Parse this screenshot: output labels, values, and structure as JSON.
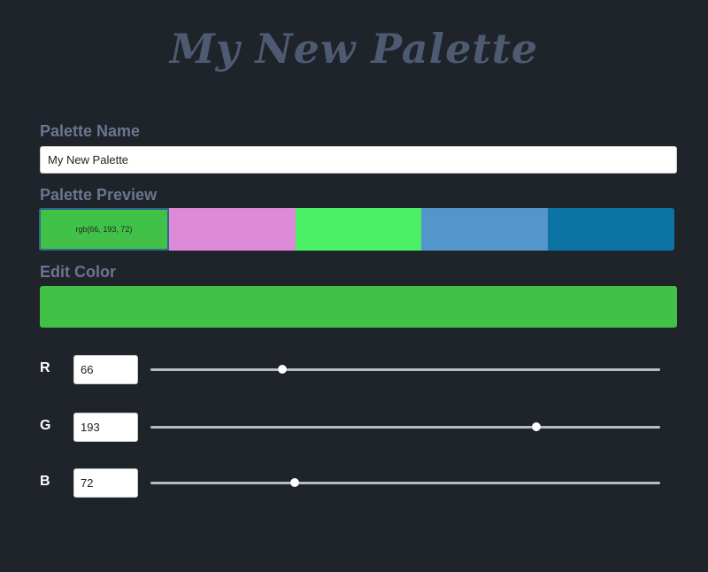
{
  "header": {
    "title": "My New Palette"
  },
  "palette_name": {
    "label": "Palette Name",
    "value": "My New Palette"
  },
  "palette_preview": {
    "label": "Palette Preview",
    "swatches": [
      {
        "color": "#42c148",
        "text": "rgb(66, 193, 72)",
        "selected": true
      },
      {
        "color": "#dd8ad9",
        "text": "",
        "selected": false
      },
      {
        "color": "#4cf065",
        "text": "",
        "selected": false
      },
      {
        "color": "#5496cb",
        "text": "",
        "selected": false
      },
      {
        "color": "#0c74a4",
        "text": "",
        "selected": false
      }
    ]
  },
  "edit_color": {
    "label": "Edit Color",
    "color": "#42c148"
  },
  "channels": {
    "r": {
      "label": "R",
      "value": "66",
      "max": 255
    },
    "g": {
      "label": "G",
      "value": "193",
      "max": 255
    },
    "b": {
      "label": "B",
      "value": "72",
      "max": 255
    }
  },
  "colors": {
    "background": "#1f232a",
    "muted_text": "#6a7690"
  }
}
